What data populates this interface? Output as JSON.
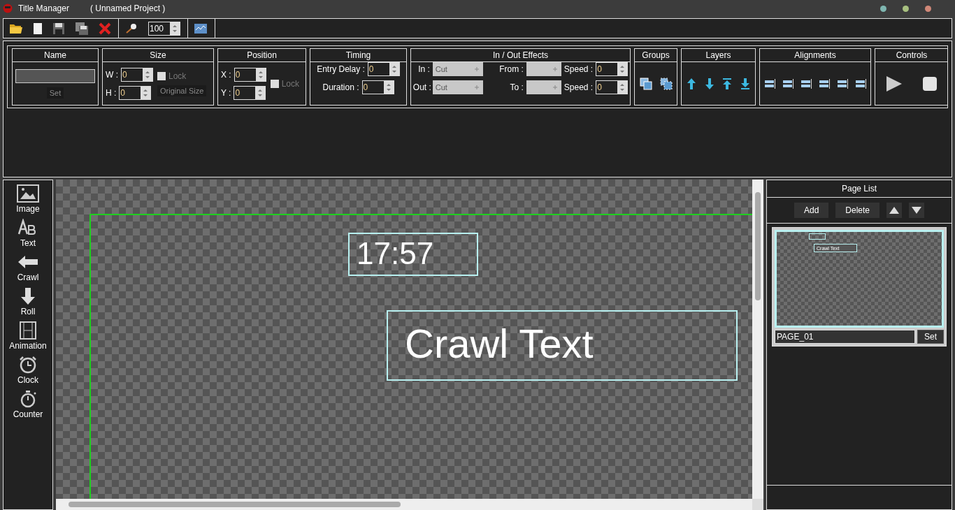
{
  "window": {
    "title": "Title Manager",
    "project": "( Unnamed Project )"
  },
  "toolbar": {
    "zoom": "100"
  },
  "name_group": {
    "title": "Name",
    "set": {
      "label": "Set",
      "disabled": true
    }
  },
  "size_group": {
    "title": "Size",
    "fields": [
      {
        "label": "W :",
        "value": "0"
      },
      {
        "label": "H :",
        "value": "0"
      }
    ],
    "lock": {
      "label": "Lock",
      "checked": false,
      "disabled": true
    },
    "original": {
      "label": "Original Size",
      "disabled": true
    }
  },
  "position_group": {
    "title": "Position",
    "fields": [
      {
        "label": "X :",
        "value": "0"
      },
      {
        "label": "Y :",
        "value": "0"
      }
    ],
    "lock": {
      "label": "Lock",
      "checked": false,
      "disabled": true
    }
  },
  "timing_group": {
    "title": "Timing",
    "fields": [
      {
        "label": "Entry Delay :",
        "value": "0"
      },
      {
        "label": "Duration :",
        "value": "0"
      }
    ]
  },
  "effects_group": {
    "title": "In / Out Effects",
    "rows": [
      {
        "label": "In :",
        "effect": "Cut",
        "dir_label": "From :",
        "speed_label": "Speed  :",
        "speed": "0"
      },
      {
        "label": "Out :",
        "effect": "Cut",
        "dir_label": "To :",
        "speed_label": "Speed  :",
        "speed": "0"
      }
    ]
  },
  "groups_group": {
    "title": "Groups"
  },
  "layers_group": {
    "title": "Layers"
  },
  "alignments_group": {
    "title": "Alignments"
  },
  "controls_group": {
    "title": "Controls"
  },
  "tools": [
    {
      "label": "Image",
      "kind": "image"
    },
    {
      "label": "Text",
      "kind": "text"
    },
    {
      "label": "Crawl",
      "kind": "crawl"
    },
    {
      "label": "Roll",
      "kind": "roll"
    },
    {
      "label": "Animation",
      "kind": "animation"
    },
    {
      "label": "Clock",
      "kind": "clock"
    },
    {
      "label": "Counter",
      "kind": "counter"
    }
  ],
  "canvas": {
    "items": [
      {
        "kind": "clock",
        "text": "17:57"
      },
      {
        "kind": "crawl",
        "text": "Crawl Text"
      }
    ]
  },
  "page_list": {
    "title": "Page List",
    "buttons": [
      "Add",
      "Delete"
    ],
    "pages": [
      {
        "name": "PAGE_01",
        "selected": true,
        "thumb_text": "Crawl Text",
        "set": "Set"
      }
    ]
  }
}
